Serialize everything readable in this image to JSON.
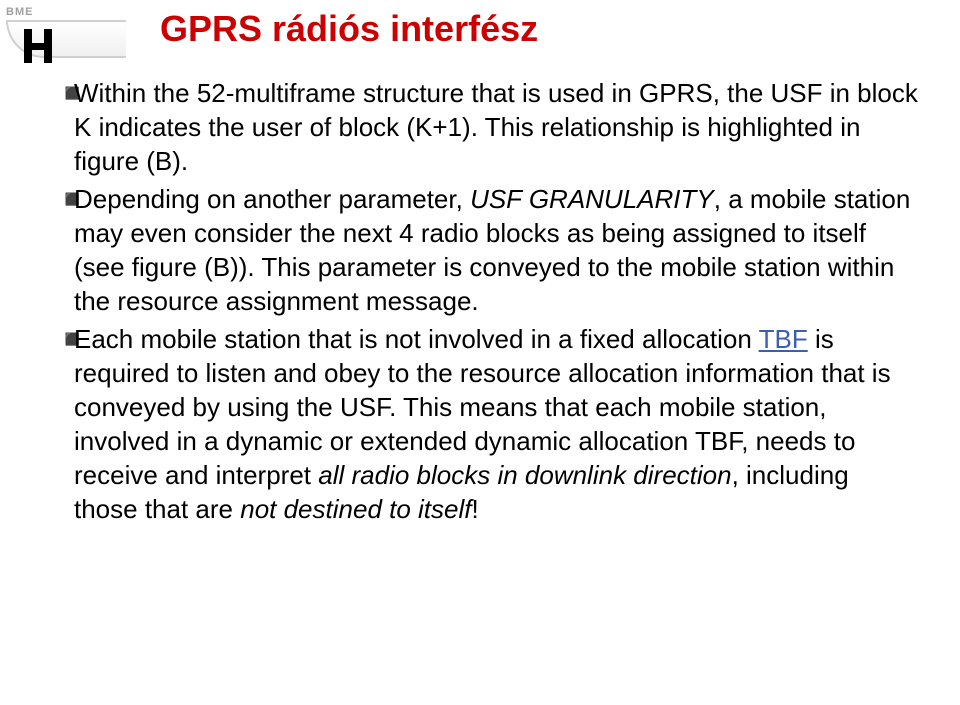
{
  "logo": {
    "org": "BME"
  },
  "title": "GPRS rádiós interfész",
  "bullets": [
    {
      "runs": [
        {
          "t": "Within the 52-multiframe structure that is used in GPRS, the USF in block K indicates the user of block (K+1). This relationship is highlighted in figure (B)."
        }
      ]
    },
    {
      "runs": [
        {
          "t": "Depending on another parameter, "
        },
        {
          "t": "USF GRANULARITY",
          "style": "italic"
        },
        {
          "t": ", a mobile station may even consider the next 4 radio blocks as being assigned to itself (see figure (B)). This parameter is conveyed to the mobile station within the resource assignment message."
        }
      ]
    },
    {
      "runs": [
        {
          "t": "Each mobile station that is not involved in a fixed allocation "
        },
        {
          "t": "TBF",
          "style": "tbf"
        },
        {
          "t": " is required to listen and obey to the resource allocation information that is conveyed by using the USF. This means that each mobile station, involved in a dynamic or extended dynamic allocation TBF, needs to receive and interpret "
        },
        {
          "t": "all radio blocks in downlink direction",
          "style": "italic"
        },
        {
          "t": ", including those that are "
        },
        {
          "t": "not destined to itself",
          "style": "italic"
        },
        {
          "t": "!"
        }
      ]
    }
  ]
}
